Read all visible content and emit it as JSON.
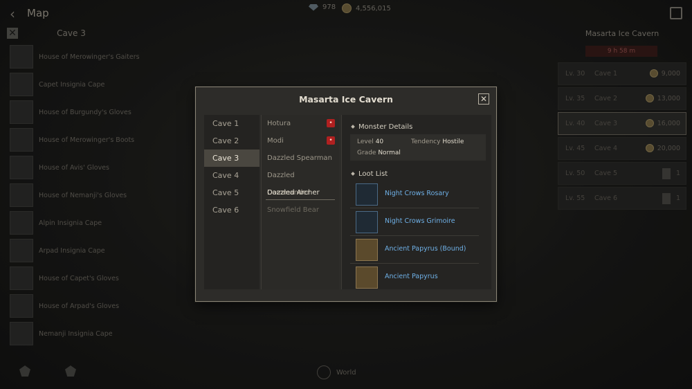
{
  "topbar": {
    "title": "Map",
    "gems": "978",
    "gold": "4,556,015"
  },
  "left": {
    "title": "Cave 3",
    "items": [
      "House of Merowinger's Gaiters",
      "Capet Insignia Cape",
      "House of Burgundy's Gloves",
      "House of Merowinger's Boots",
      "House of Avis' Gloves",
      "House of Nemanji's Gloves",
      "Alpin Insignia Cape",
      "Arpad Insignia Cape",
      "House of Capet's Gloves",
      "House of Arpad's Gloves",
      "Nemanji Insignia Cape"
    ]
  },
  "world_label": "World",
  "right": {
    "title": "Masarta Ice Cavern",
    "timer": "9 h 58 m",
    "rows": [
      {
        "lv": "Lv. 30",
        "cave": "Cave 1",
        "cost": "9,000",
        "type": "gold"
      },
      {
        "lv": "Lv. 35",
        "cave": "Cave 2",
        "cost": "13,000",
        "type": "gold"
      },
      {
        "lv": "Lv. 40",
        "cave": "Cave 3",
        "cost": "16,000",
        "type": "gold"
      },
      {
        "lv": "Lv. 45",
        "cave": "Cave 4",
        "cost": "20,000",
        "type": "gold"
      },
      {
        "lv": "Lv. 50",
        "cave": "Cave 5",
        "cost": "1",
        "type": "scroll"
      },
      {
        "lv": "Lv. 55",
        "cave": "Cave 6",
        "cost": "1",
        "type": "scroll"
      }
    ]
  },
  "modal": {
    "title": "Masarta Ice Cavern",
    "caves": [
      "Cave 1",
      "Cave 2",
      "Cave 3",
      "Cave 4",
      "Cave 5",
      "Cave 6"
    ],
    "monsters": [
      "Hotura",
      "Modi",
      "Dazzled Spearman",
      "Dazzled Commander",
      "Dazzled Archer",
      "Snowfield Bear"
    ],
    "details_header": "Monster Details",
    "level_label": "Level",
    "level_value": "40",
    "tendency_label": "Tendency",
    "tendency_value": "Hostile",
    "grade_label": "Grade",
    "grade_value": "Normal",
    "loot_header": "Loot List",
    "loot": [
      "Night Crows Rosary",
      "Night Crows Grimoire",
      "Ancient Papyrus (Bound)",
      "Ancient Papyrus"
    ]
  },
  "colors": {
    "loot_name": "#6fb0e6",
    "boss_tag": "#b02020",
    "timer_bg": "#3a1c1a"
  }
}
